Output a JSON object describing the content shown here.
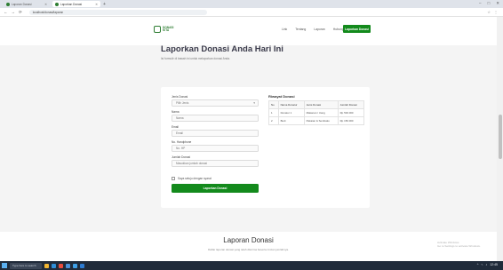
{
  "browser": {
    "tabs": [
      {
        "title": "Laporan Donasi"
      },
      {
        "title": "Laporkan Donasi"
      }
    ],
    "new_tab": "+",
    "window_controls": [
      "–",
      "□",
      "✕"
    ],
    "nav_buttons": [
      "←",
      "→",
      "⟳"
    ],
    "url": "localhost/donasi/laporan",
    "ext_icons": [
      "☆",
      "⋮"
    ]
  },
  "site": {
    "logo_text_line1": "DONASI",
    "logo_text_line2": "KITA",
    "menu": [
      "Link",
      "Tentang",
      "Laporan",
      "Hubungi Kami"
    ],
    "cta_label": "Laporkan Donasi"
  },
  "form_section": {
    "heading": "Laporkan Donasi Anda Hari Ini",
    "subheading": "Isi formulir di bawah ini untuk melaporkan donasi Anda.",
    "fields": [
      {
        "label": "Jenis Donasi",
        "value": "Pilih Jenis",
        "is_select": true
      },
      {
        "label": "Nama",
        "value": "Nama"
      },
      {
        "label": "Email",
        "value": "Email"
      },
      {
        "label": "No. Handphone",
        "value": "No. HP"
      },
      {
        "label": "Jumlah Donasi",
        "value": "Masukkan jumlah donasi"
      }
    ],
    "checkbox_label": "Saya setuju dengan syarat",
    "submit_label": "Laporkan Donasi"
  },
  "table_section": {
    "title": "Riwayat Donasi",
    "headers": [
      "No",
      "Nama Donatur",
      "Jenis Donasi",
      "Jumlah Donasi"
    ],
    "rows": [
      [
        "1",
        "Donatur 1",
        "Makanan / Uang",
        "Rp 500.000"
      ],
      [
        "2",
        "Budi",
        "Pakaian & Sembako",
        "Rp 150.000"
      ]
    ]
  },
  "report_section": {
    "title": "Laporan Donasi",
    "subtitle": "Daftar laporan donasi yang telah diterima beserta rincian jumlahnya."
  },
  "watermark": {
    "line1": "Activate Windows",
    "line2": "Go to Settings to activate Windows."
  },
  "taskbar": {
    "search_placeholder": "Type here to search",
    "apps": [
      {
        "name": "file-explorer",
        "color": "#f2b632"
      },
      {
        "name": "edge-browser",
        "color": "#2f8fd8"
      },
      {
        "name": "chrome-browser",
        "color": "#e84c3d"
      },
      {
        "name": "store",
        "color": "#4a90d9"
      },
      {
        "name": "mail",
        "color": "#3fa0e6"
      },
      {
        "name": "vscode",
        "color": "#2d7bd1"
      }
    ],
    "tray_time": "12:45",
    "tray_icons": [
      "^",
      "⌁",
      "♪"
    ]
  }
}
